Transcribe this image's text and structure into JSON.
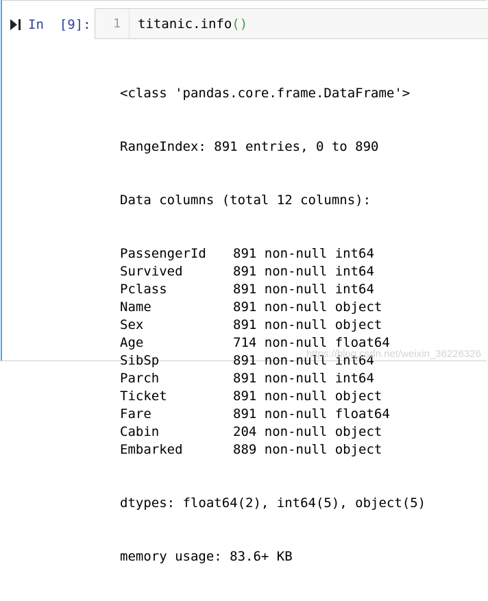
{
  "cell": {
    "prompt": "In  [9]:",
    "line_number": "1",
    "code_func": "titanic.info",
    "code_parens": "()"
  },
  "output": {
    "class_line": "<class 'pandas.core.frame.DataFrame'>",
    "range_line": "RangeIndex: 891 entries, 0 to 890",
    "columns_header": "Data columns (total 12 columns):",
    "columns": [
      {
        "name": "PassengerId",
        "info": "891 non-null int64"
      },
      {
        "name": "Survived",
        "info": "891 non-null int64"
      },
      {
        "name": "Pclass",
        "info": "891 non-null int64"
      },
      {
        "name": "Name",
        "info": "891 non-null object"
      },
      {
        "name": "Sex",
        "info": "891 non-null object"
      },
      {
        "name": "Age",
        "info": "714 non-null float64"
      },
      {
        "name": "SibSp",
        "info": "891 non-null int64"
      },
      {
        "name": "Parch",
        "info": "891 non-null int64"
      },
      {
        "name": "Ticket",
        "info": "891 non-null object"
      },
      {
        "name": "Fare",
        "info": "891 non-null float64"
      },
      {
        "name": "Cabin",
        "info": "204 non-null object"
      },
      {
        "name": "Embarked",
        "info": "889 non-null object"
      }
    ],
    "dtypes_line": "dtypes: float64(2), int64(5), object(5)",
    "memory_line": "memory usage: 83.6+ KB"
  },
  "watermark": "https://blog.csdn.net/weixin_36226326",
  "colors": {
    "prompt": "#303f9f",
    "selected_border": "#42a5f5",
    "paren": "#39a339"
  },
  "icons": {
    "run": "run-cell-icon"
  }
}
